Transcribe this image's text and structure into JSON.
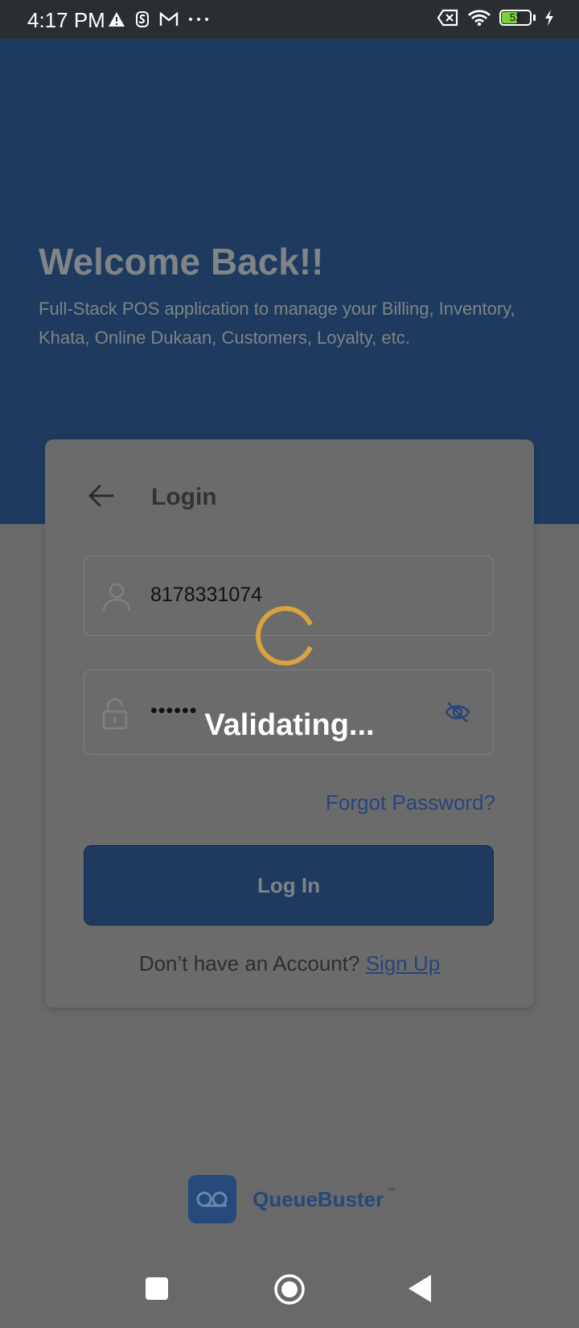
{
  "status_bar": {
    "time": "4:17 PM",
    "left_icons": [
      "warning-icon",
      "s-app-icon",
      "gmail-icon",
      "more-icon"
    ],
    "right_icons": [
      "no-sim-icon",
      "wifi-icon",
      "battery-icon",
      "charging-icon"
    ],
    "battery_level": "52"
  },
  "hero": {
    "title": "Welcome Back!!",
    "subtitle": "Full-Stack POS application to manage your Billing, Inventory, Khata, Online Dukaan, Customers, Loyalty, etc."
  },
  "login_card": {
    "title": "Login",
    "phone_value": "8178331074",
    "password_value": "••••••",
    "forgot_password": "Forgot Password?",
    "login_button": "Log In",
    "no_account_text": "Don’t have an Account? ",
    "signup_link": "Sign Up"
  },
  "loading_overlay": {
    "text": "Validating..."
  },
  "brand": {
    "name": "QueueBuster",
    "trademark": "™"
  },
  "navigation": [
    "recent-apps",
    "home",
    "back"
  ],
  "colors": {
    "hero_background": "#1e3a5e",
    "accent": "#25467a",
    "spinner": "#d7a23f",
    "overlay": "#696969"
  }
}
